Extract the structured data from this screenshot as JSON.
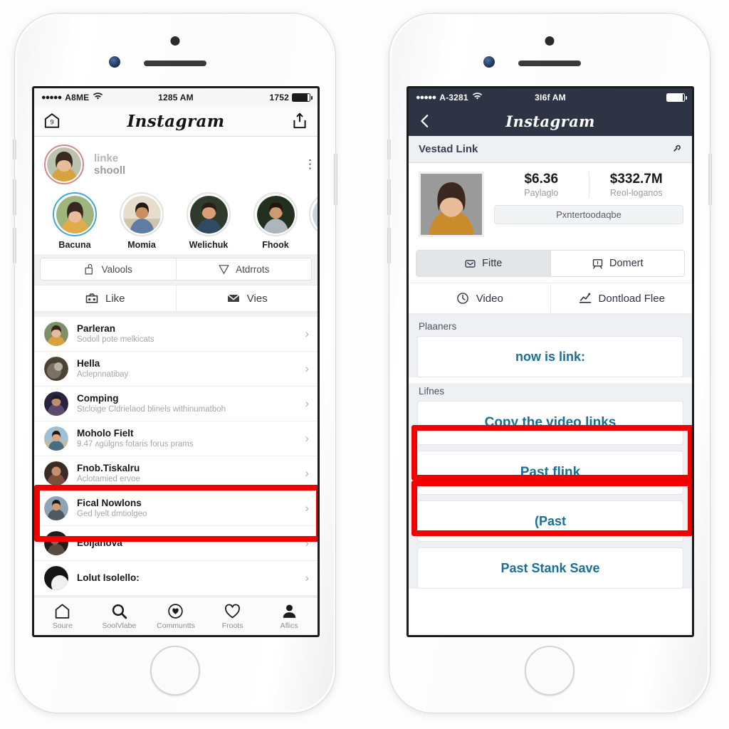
{
  "left_phone": {
    "statusbar": {
      "dots": "●●●●●",
      "carrier": "A8ME",
      "time": "1285 AM",
      "battery_text": "1752"
    },
    "nav": {
      "title": "Instagram",
      "left_icon": "home-badge-icon",
      "right_icon": "share-upload-icon"
    },
    "profile": {
      "line1": "linke",
      "line2": "shooll",
      "menu_icon": "kebab-menu-icon"
    },
    "stories": [
      {
        "name": "Bacuna",
        "active": true
      },
      {
        "name": "Momia",
        "active": false
      },
      {
        "name": "Welichuk",
        "active": false
      },
      {
        "name": "Fhook",
        "active": false
      }
    ],
    "actions_row1": [
      {
        "label": "Valools",
        "icon": "tag-icon"
      },
      {
        "label": "Atdrrots",
        "icon": "send-icon"
      }
    ],
    "actions_row2": [
      {
        "label": "Like",
        "icon": "camera-icon"
      },
      {
        "label": "Vies",
        "icon": "envelope-icon"
      }
    ],
    "list": [
      {
        "title": "Parleran",
        "sub": "Sodoll pote melkicats"
      },
      {
        "title": "Hella",
        "sub": "Aclepnnatibay"
      },
      {
        "title": "Comping",
        "sub": "Stcloige Cldrielaod blinels withinumatboh"
      },
      {
        "title": "Moholo Fielt",
        "sub": "9.47 ʌgülgns fotaris forus prams"
      },
      {
        "title": "Fnob.Tiskalru",
        "sub": "Aclotamied ervoe"
      },
      {
        "title": "Fical Nowlons",
        "sub": "Ged lyelt dmtiolgeo"
      },
      {
        "title": "Eoljanova",
        "sub": ""
      },
      {
        "title": "Lolut Isolello:",
        "sub": ""
      }
    ],
    "highlight_index": 5,
    "tabs": [
      {
        "label": "Soure",
        "icon": "home-icon"
      },
      {
        "label": "SoolVlabe",
        "icon": "search-icon"
      },
      {
        "label": "Communtts",
        "icon": "badge-heart-icon"
      },
      {
        "label": "Froots",
        "icon": "heart-icon"
      },
      {
        "label": "Aflics",
        "icon": "person-icon"
      }
    ]
  },
  "right_phone": {
    "statusbar": {
      "dots": "●●●●●",
      "carrier": "A-3281",
      "time": "3I6f AM",
      "battery_text": ""
    },
    "nav": {
      "title": "Instagram",
      "back_icon": "chevron-left-icon"
    },
    "section": {
      "title": "Vestad Link",
      "icon": "link-chain-icon"
    },
    "stats": [
      {
        "value": "$6.36",
        "label": "Paylaglo"
      },
      {
        "value": "$332.7M",
        "label": "Reol-loganos"
      }
    ],
    "stat_cta": "Pxntertoodaqbe",
    "segments": [
      {
        "label": "Fitte",
        "icon": "inbox-icon",
        "selected": true
      },
      {
        "label": "Domert",
        "icon": "comment-icon",
        "selected": false
      }
    ],
    "row2": [
      {
        "label": "Video",
        "icon": "clock-icon"
      },
      {
        "label": "Dontload Flee",
        "icon": "download-chart-icon"
      }
    ],
    "groups": [
      {
        "header": "Plaaners",
        "buttons": [
          {
            "label": "now is link:",
            "highlighted": false,
            "size": "mid"
          }
        ]
      },
      {
        "header": "Lifnes",
        "buttons": [
          {
            "label": "Copy the video links",
            "highlighted": true,
            "size": "tall"
          },
          {
            "label": "Past flink",
            "highlighted": true,
            "size": "tall"
          },
          {
            "label": "(Past",
            "highlighted": false,
            "size": "mid"
          },
          {
            "label": "Past Stank Save",
            "highlighted": false,
            "size": "mid"
          }
        ]
      }
    ]
  },
  "colors": {
    "highlight": "#f20000",
    "dark_nav": "#2e3444",
    "link_blue": "#1b6f96",
    "story_ring_active": "#3fa8d8"
  }
}
